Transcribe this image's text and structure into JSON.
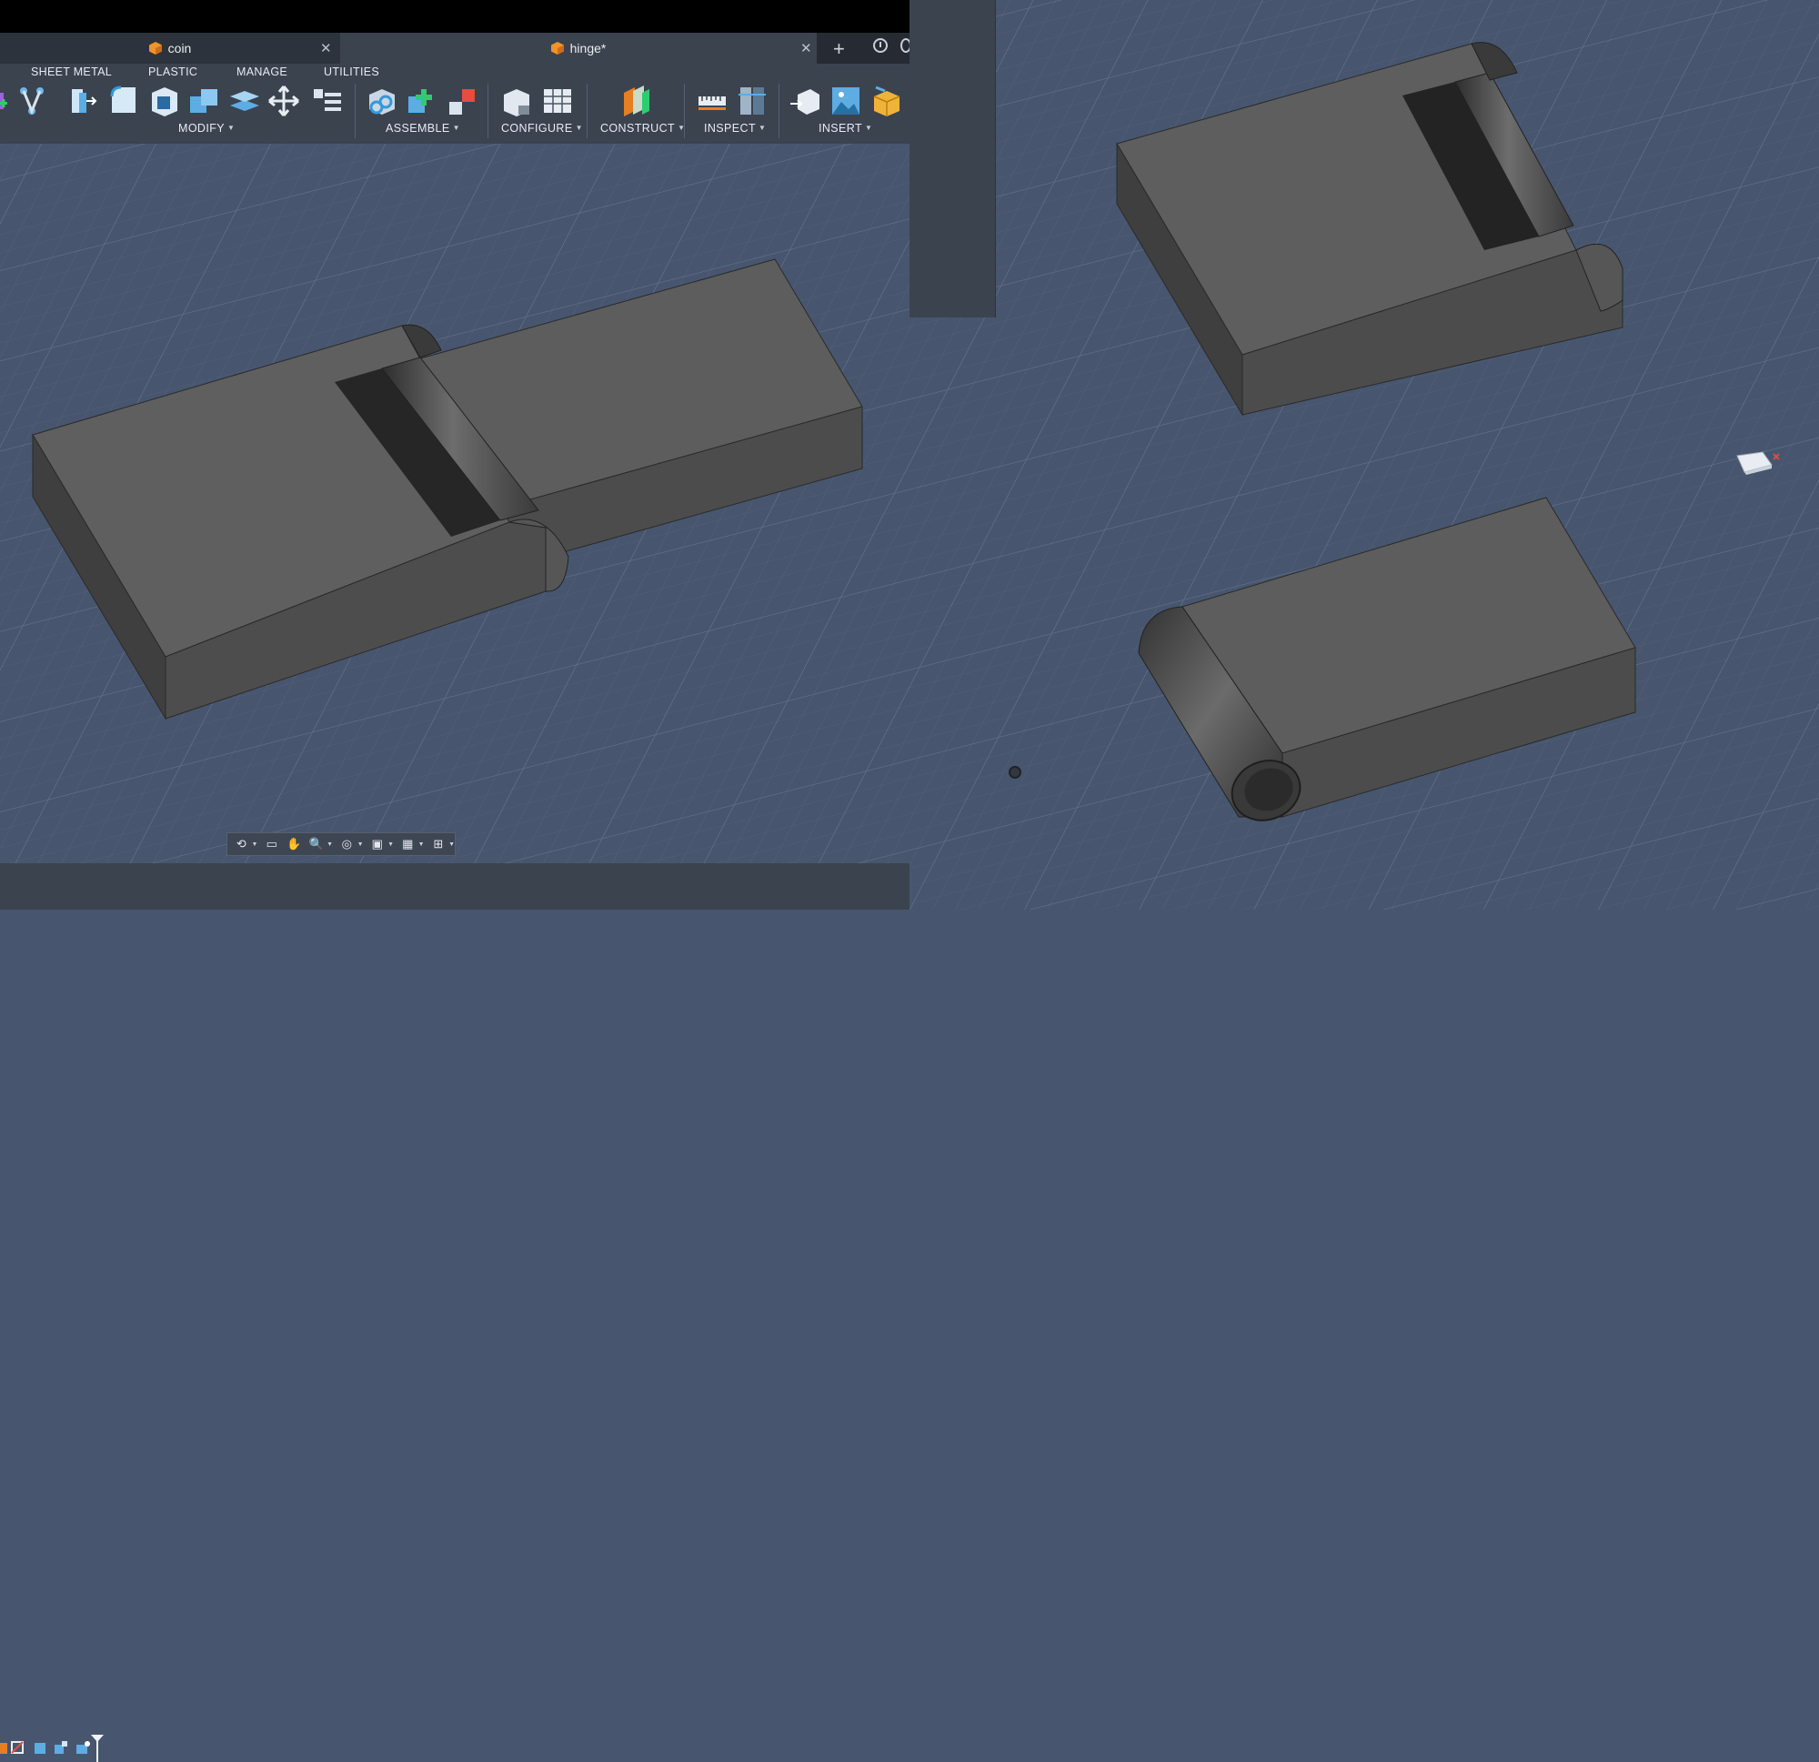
{
  "document_tabs": [
    {
      "label": "coin",
      "active": false
    },
    {
      "label": "hinge*",
      "active": true
    }
  ],
  "workspace_tabs": [
    "SHEET METAL",
    "PLASTIC",
    "MANAGE",
    "UTILITIES"
  ],
  "toolbar_groups": [
    {
      "label": "MODIFY"
    },
    {
      "label": "ASSEMBLE"
    },
    {
      "label": "CONFIGURE"
    },
    {
      "label": "CONSTRUCT"
    },
    {
      "label": "INSPECT"
    },
    {
      "label": "INSERT"
    }
  ],
  "icons": {
    "document": "orange-cube-icon",
    "close": "close-icon",
    "new_tab": "plus-icon",
    "history": "clock-icon"
  },
  "colors": {
    "viewport_bg": "#47566e",
    "grid_line": "#5a6a84",
    "ribbon_bg": "#3b434f",
    "tab_active_bg": "#3b434f",
    "tab_inactive_bg": "#2d333c",
    "model_top": "#5d5d5d",
    "model_front": "#4c4c4c",
    "model_side": "#3e3e3e",
    "accent_orange": "#f0932b"
  }
}
